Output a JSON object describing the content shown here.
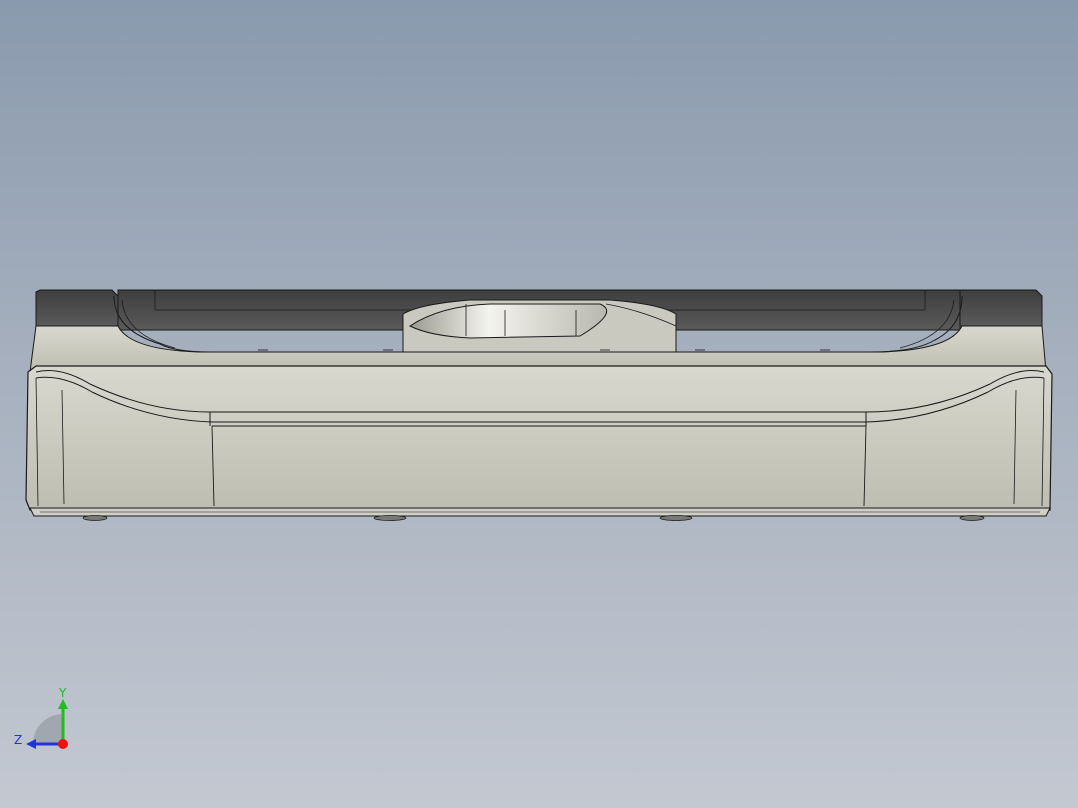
{
  "viewport": {
    "background_top": "#8a9aae",
    "background_bottom": "#c3c8d1"
  },
  "model": {
    "body_color": "#c8c8bc",
    "body_shadow": "#b9b9ad",
    "top_face_color": "#d6d6cc",
    "dark_panel_color": "#4a4a4a",
    "edge_color": "#1a1a1a",
    "hole_color": "#6a6a6a"
  },
  "triad": {
    "y_label": "Y",
    "z_label": "Z",
    "y_color": "#22bb22",
    "z_color": "#2233dd",
    "origin_color": "#ee1111",
    "icon": "view-orientation-triad-icon"
  }
}
